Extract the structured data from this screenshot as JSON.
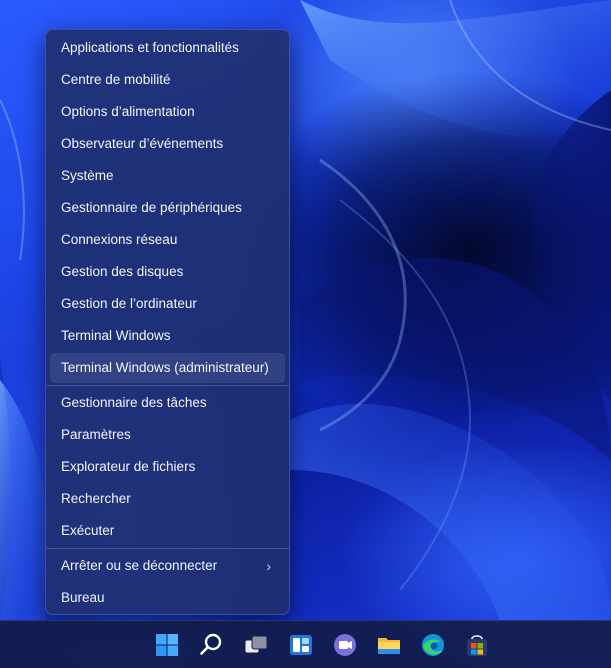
{
  "menu": {
    "items": [
      {
        "label": "Applications et fonctionnalités"
      },
      {
        "label": "Centre de mobilité"
      },
      {
        "label": "Options d’alimentation"
      },
      {
        "label": "Observateur d’événements"
      },
      {
        "label": "Système"
      },
      {
        "label": "Gestionnaire de périphériques"
      },
      {
        "label": "Connexions réseau"
      },
      {
        "label": "Gestion des disques"
      },
      {
        "label": "Gestion de l’ordinateur"
      },
      {
        "label": "Terminal Windows"
      },
      {
        "label": "Terminal Windows (administrateur)"
      },
      {
        "label": "Gestionnaire des tâches"
      },
      {
        "label": "Paramètres"
      },
      {
        "label": "Explorateur de fichiers"
      },
      {
        "label": "Rechercher"
      },
      {
        "label": "Exécuter"
      },
      {
        "label": "Arrêter ou se déconnecter"
      },
      {
        "label": "Bureau"
      }
    ],
    "highlighted": "Terminal Windows (administrateur)",
    "submenu_glyph": "›"
  },
  "taskbar": {
    "icons": [
      "windows-start-icon",
      "search-icon",
      "task-view-icon",
      "widgets-icon",
      "teams-chat-icon",
      "file-explorer-icon",
      "edge-icon",
      "store-icon"
    ]
  },
  "colors": {
    "menu_background": "#203070",
    "taskbar_background": "#121c4a",
    "accent_blue": "#1f5bff"
  }
}
